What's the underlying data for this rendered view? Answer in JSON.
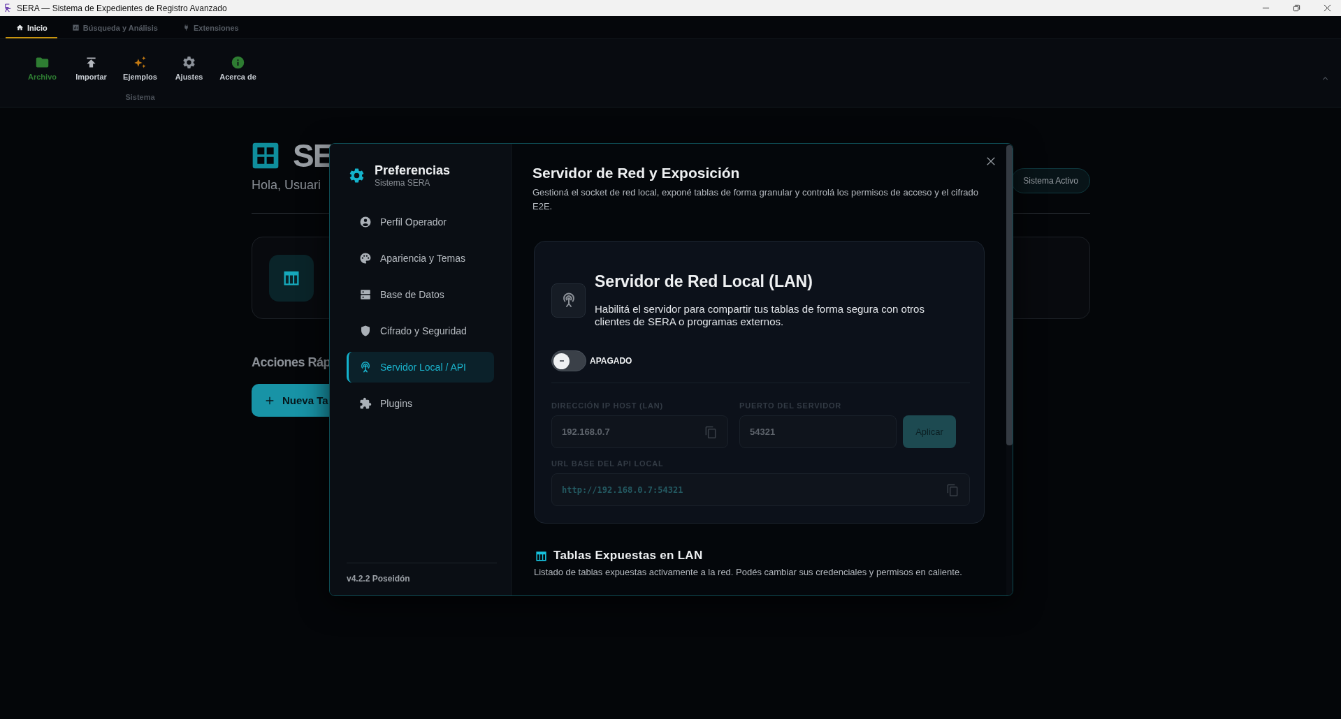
{
  "window": {
    "title": "SERA — Sistema de Expedientes de Registro Avanzado"
  },
  "ribbon": {
    "tabs": [
      {
        "label": "Inicio",
        "selected": true
      },
      {
        "label": "Búsqueda y Análisis",
        "selected": false
      },
      {
        "label": "Extensiones",
        "selected": false
      }
    ],
    "groups": [
      {
        "label": "Sistema",
        "buttons": [
          {
            "label": "Archivo",
            "active": true,
            "color": "#2e7d32"
          },
          {
            "label": "Importar",
            "active": false,
            "color": "#b4b8be"
          },
          {
            "label": "Ejemplos",
            "active": false,
            "color": "#c47a12"
          },
          {
            "label": "Ajustes",
            "active": false,
            "color": "#8c929a"
          },
          {
            "label": "Acerca de",
            "active": false,
            "color": "#2e7d32"
          }
        ]
      }
    ]
  },
  "home": {
    "title": "SE",
    "greeting": "Hola, Usuari",
    "status": "Sistema Activo",
    "section_title": "Acciones Ráp",
    "new_button": "Nueva Ta"
  },
  "preferences": {
    "title": "Preferencias",
    "subtitle": "Sistema SERA",
    "nav": [
      {
        "label": "Perfil Operador",
        "selected": false
      },
      {
        "label": "Apariencia y Temas",
        "selected": false
      },
      {
        "label": "Base de Datos",
        "selected": false
      },
      {
        "label": "Cifrado y Seguridad",
        "selected": false
      },
      {
        "label": "Servidor Local / API",
        "selected": true
      },
      {
        "label": "Plugins",
        "selected": false
      }
    ],
    "version": "v4.2.2 Poseidón",
    "content": {
      "title": "Servidor de Red y Exposición",
      "description": "Gestioná el socket de red local, exponé tablas de forma granular y controlá los permisos de acceso y el cifrado E2E.",
      "server_card": {
        "title": "Servidor de Red Local (LAN)",
        "description": "Habilitá el servidor para compartir tus tablas de forma segura con otros clientes de SERA o programas externos.",
        "toggle": {
          "on": false,
          "label": "APAGADO"
        },
        "host": {
          "label": "DIRECCIÓN IP HOST (LAN)",
          "value": "192.168.0.7",
          "disabled": true
        },
        "port": {
          "label": "PUERTO DEL SERVIDOR",
          "value": "54321",
          "disabled": true
        },
        "apply_button": {
          "label": "Aplicar",
          "disabled": true
        },
        "url": {
          "label": "URL BASE DEL API LOCAL",
          "value": "http://192.168.0.7:54321",
          "disabled": true
        }
      },
      "tables_section": {
        "title": "Tablas Expuestas en LAN",
        "description": "Listado de tablas expuestas activamente a la red. Podés cambiar sus credenciales y permisos en caliente."
      }
    }
  }
}
